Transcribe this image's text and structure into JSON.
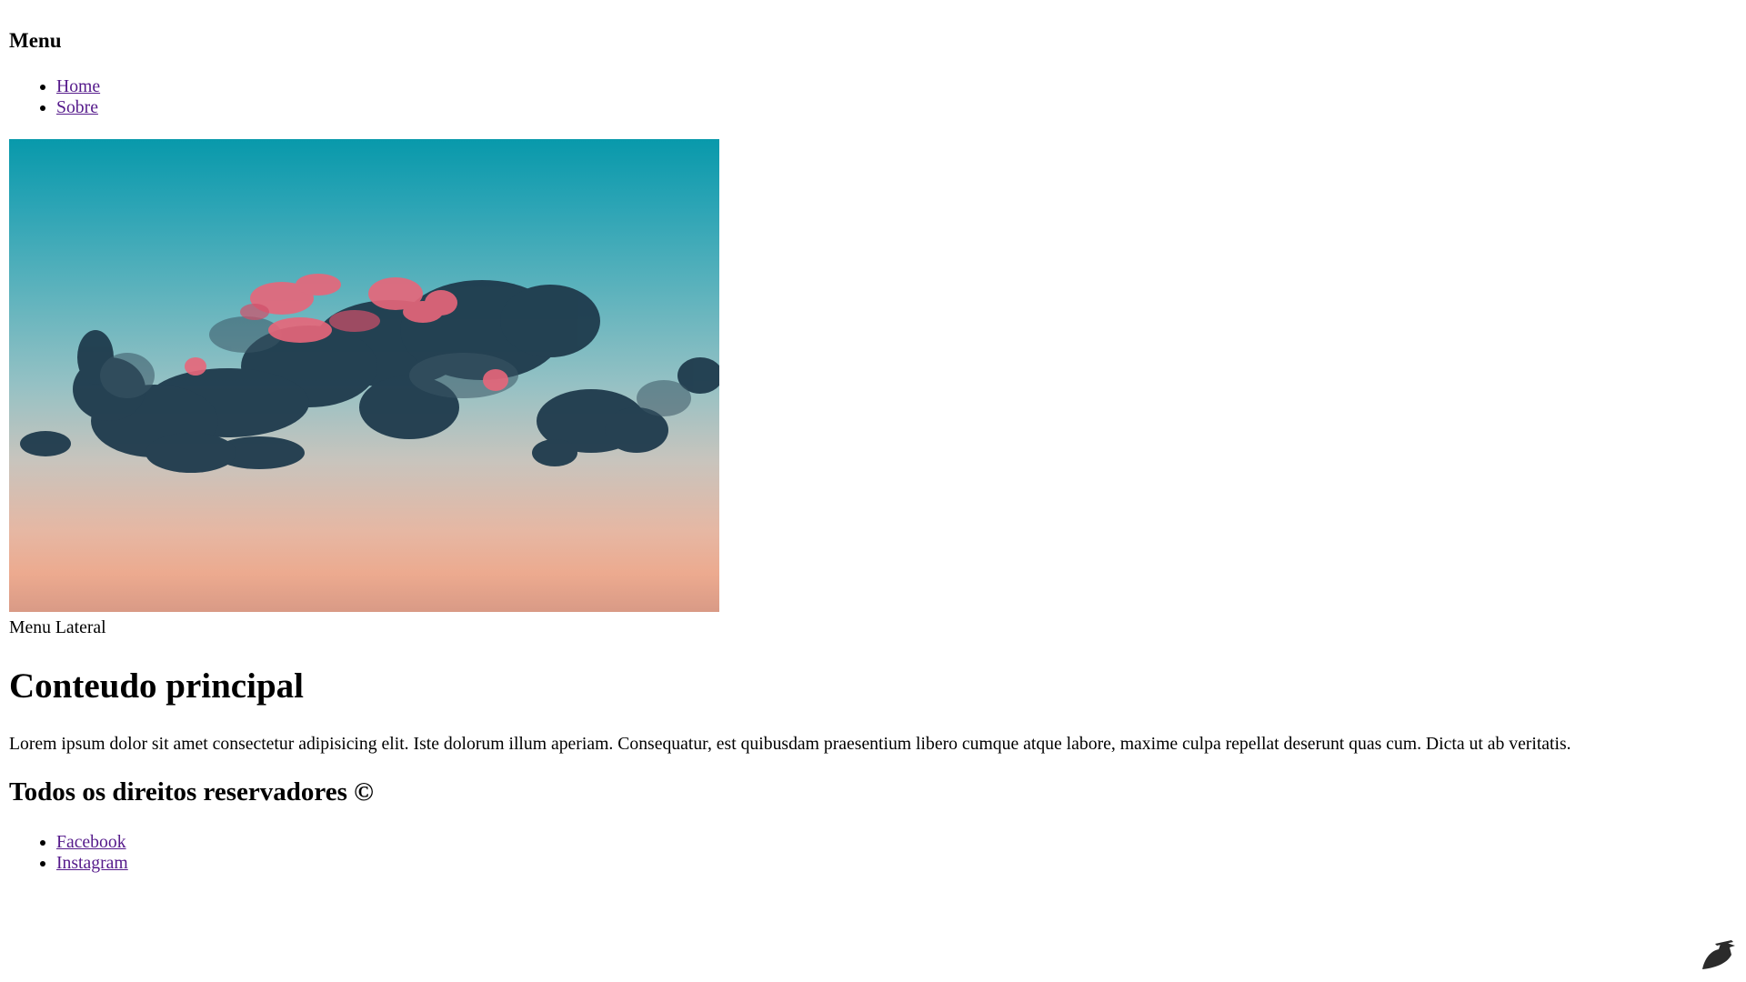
{
  "header": {
    "menu_title": "Menu",
    "nav": [
      {
        "label": "Home"
      },
      {
        "label": "Sobre"
      }
    ]
  },
  "hero": {
    "image": "sky-clouds-photo"
  },
  "sidebar": {
    "label": "Menu Lateral"
  },
  "main": {
    "title": "Conteudo principal",
    "text": "Lorem ipsum dolor sit amet consectetur adipisicing elit. Iste dolorum illum aperiam. Consequatur, est quibusdam praesentium libero cumque atque labore, maxime culpa repellat deserunt quas cum. Dicta ut ab veritatis."
  },
  "footer": {
    "title": "Todos os direitos reservadores ©",
    "links": [
      {
        "label": "Facebook"
      },
      {
        "label": "Instagram"
      }
    ]
  },
  "colors": {
    "link_visited": "#551a8b",
    "text": "#000000",
    "background": "#ffffff"
  },
  "icons": {
    "corner": "bird-logo-icon"
  }
}
